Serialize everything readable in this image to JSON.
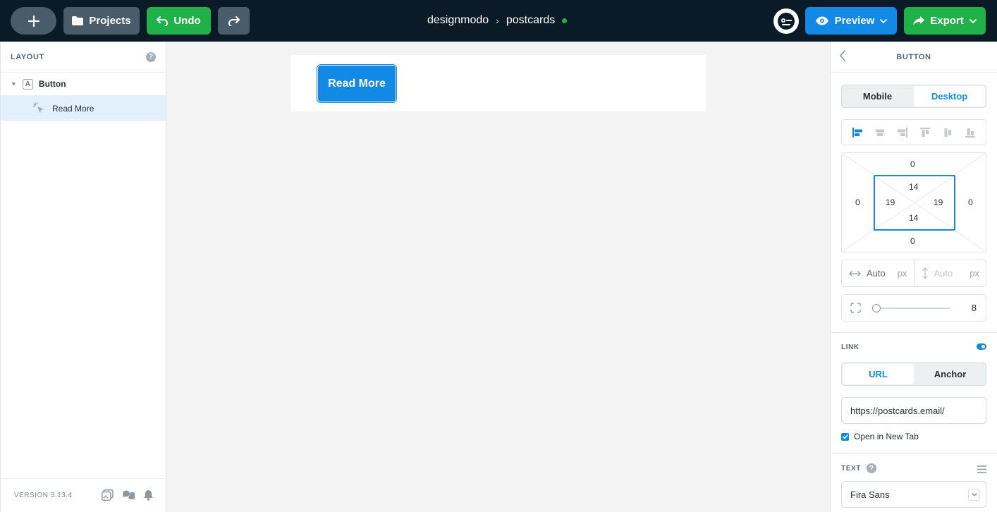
{
  "topbar": {
    "projects_label": "Projects",
    "undo_label": "Undo",
    "preview_label": "Preview",
    "export_label": "Export",
    "breadcrumb": {
      "workspace": "designmodo",
      "separator": "›",
      "project": "postcards"
    },
    "status_color": "#21b14a"
  },
  "layout_panel": {
    "title": "LAYOUT",
    "help": "?",
    "tree": [
      {
        "icon": "A",
        "label": "Button",
        "expanded": true
      },
      {
        "label": "Read More",
        "selected": true
      }
    ],
    "version": "VERSION 3.13.4"
  },
  "canvas": {
    "button_label": "Read More",
    "accent": "#1389e6"
  },
  "props_panel": {
    "title": "BUTTON",
    "device_tabs": [
      "Mobile",
      "Desktop"
    ],
    "active_device": "Desktop",
    "margin": {
      "top": "0",
      "right": "0",
      "bottom": "0",
      "left": "0"
    },
    "padding": {
      "top": "14",
      "right": "19",
      "bottom": "14",
      "left": "19"
    },
    "width": {
      "value": "Auto",
      "unit": "px"
    },
    "height": {
      "value": "Auto",
      "unit": "px"
    },
    "radius": "8",
    "link_label": "LINK",
    "link_enabled": true,
    "link_tabs": [
      "URL",
      "Anchor"
    ],
    "active_link_tab": "URL",
    "url_value": "https://postcards.email/",
    "new_tab_label": "Open in New Tab",
    "new_tab_checked": true,
    "text_label": "TEXT",
    "text_help": "?",
    "font_value": "Fira Sans"
  }
}
